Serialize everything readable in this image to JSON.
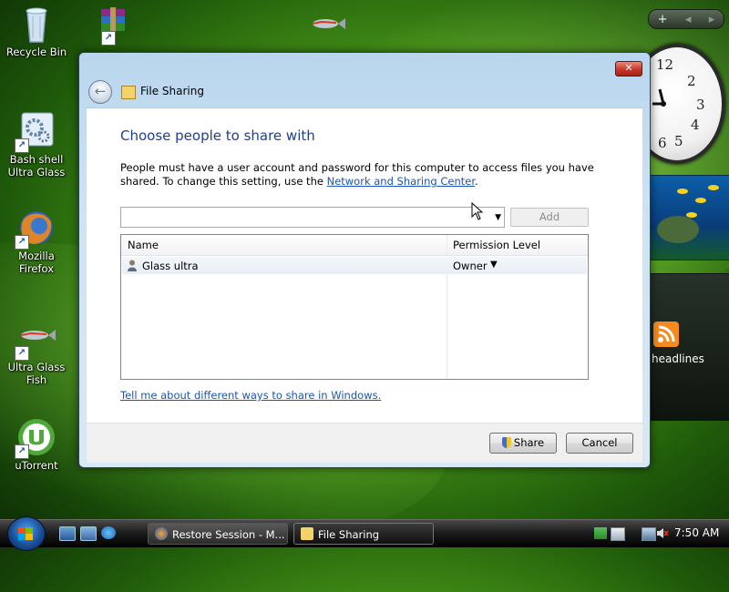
{
  "desktop": {
    "icons": [
      {
        "label": "Recycle Bin"
      },
      {
        "label": "Bash shell Ultra Glass"
      },
      {
        "label": "Mozilla Firefox"
      },
      {
        "label": "Ultra Glass Fish"
      },
      {
        "label": "uTorrent"
      }
    ]
  },
  "sidebar": {
    "add_label": "+",
    "headlines_label": "headlines",
    "clock_numbers": [
      "12",
      "2",
      "3",
      "4",
      "5",
      "6"
    ]
  },
  "dialog": {
    "title": "File Sharing",
    "close_label": "✕",
    "heading": "Choose people to share with",
    "description_text": "People must have a user account and password for this computer to access files you have shared.  To change this setting, use the ",
    "description_link": "Network and Sharing Center",
    "description_end": ".",
    "add_button": "Add",
    "table": {
      "columns": [
        "Name",
        "Permission Level"
      ],
      "rows": [
        {
          "name": "Glass ultra",
          "permission": "Owner"
        }
      ]
    },
    "help_link": "Tell me about different ways to share in Windows.",
    "share_button": "Share",
    "cancel_button": "Cancel"
  },
  "taskbar": {
    "tasks": [
      {
        "label": "Restore Session - M..."
      },
      {
        "label": "File Sharing"
      }
    ],
    "clock": "7:50 AM"
  },
  "colors": {
    "heading": "#1e3f8f",
    "link": "#1a55b8",
    "close": "#c8372a"
  }
}
